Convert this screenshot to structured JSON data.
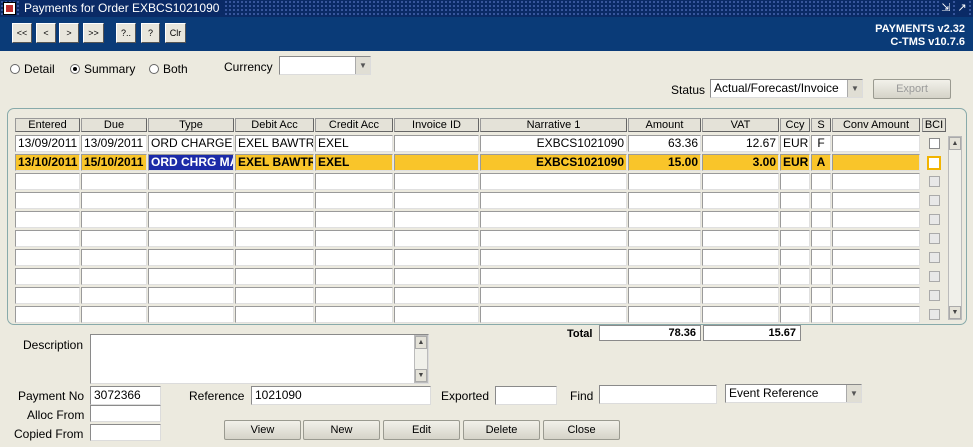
{
  "window": {
    "title": "Payments for Order EXBCS1021090",
    "controls": [
      "⇲",
      "↗"
    ]
  },
  "toolbar": {
    "first": "<<",
    "prev": "<",
    "next": ">",
    "last": ">>",
    "query": "?..",
    "help": "?",
    "clear": "Clr"
  },
  "version": {
    "app": "PAYMENTS v2.32",
    "system": "C-TMS v10.7.6"
  },
  "view_options": {
    "options": [
      "Detail",
      "Summary",
      "Both"
    ],
    "selected": "Summary"
  },
  "currency": {
    "label": "Currency",
    "value": ""
  },
  "status": {
    "label": "Status",
    "value": "Actual/Forecast/Invoice"
  },
  "export_label": "Export",
  "grid": {
    "columns": [
      "Entered",
      "Due",
      "Type",
      "Debit Acc",
      "Credit Acc",
      "Invoice ID",
      "Narrative 1",
      "Amount",
      "VAT",
      "Ccy",
      "S",
      "Conv Amount",
      "BCI"
    ],
    "rows": [
      {
        "entered": "13/09/2011",
        "due": "13/09/2011",
        "type": "ORD CHARGE",
        "debit": "EXEL BAWTR",
        "credit": "EXEL",
        "invoice": "",
        "narrative": "EXBCS1021090",
        "amount": "63.36",
        "vat": "12.67",
        "ccy": "EUR",
        "s": "F",
        "conv": "",
        "bci": false
      },
      {
        "entered": "13/10/2011",
        "due": "15/10/2011",
        "type": "ORD CHRG MAI",
        "debit": "EXEL BAWTR",
        "credit": "EXEL",
        "invoice": "",
        "narrative": "EXBCS1021090",
        "amount": "15.00",
        "vat": "3.00",
        "ccy": "EUR",
        "s": "A",
        "conv": "",
        "bci": false
      }
    ]
  },
  "totals": {
    "label": "Total",
    "amount": "78.36",
    "vat": "15.67"
  },
  "description": {
    "label": "Description",
    "value": ""
  },
  "payment_no": {
    "label": "Payment No",
    "value": "3072366"
  },
  "alloc_from": {
    "label": "Alloc From",
    "value": ""
  },
  "copied_from": {
    "label": "Copied From",
    "value": ""
  },
  "reference": {
    "label": "Reference",
    "value": "1021090"
  },
  "exported": {
    "label": "Exported",
    "value": ""
  },
  "find": {
    "label": "Find",
    "value": "",
    "type": "Event Reference"
  },
  "actions": {
    "view": "View",
    "new": "New",
    "edit": "Edit",
    "delete": "Delete",
    "close": "Close"
  }
}
